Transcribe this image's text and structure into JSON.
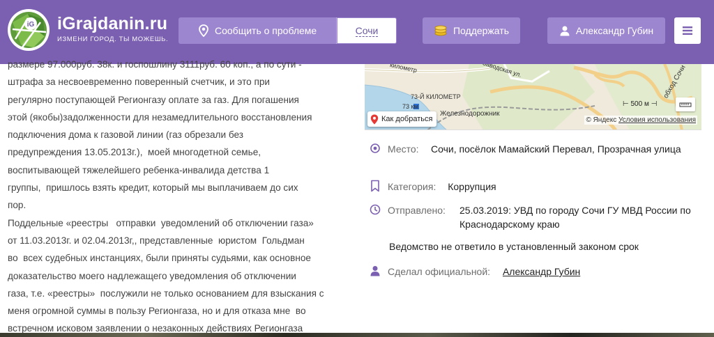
{
  "header": {
    "logo_title": "iGrajdanin.ru",
    "logo_subtitle": "ИЗМЕНИ ГОРОД. ТЫ МОЖЕШЬ.",
    "report_label": "Сообщить о проблеме",
    "city_label": "Сочи",
    "support_label": "Поддержать",
    "user_label": "Александр Губин",
    "menu_icon": "hamburger-icon",
    "accent_color": "#7b5fb0"
  },
  "article": {
    "text": "размере 97.000руб. 38к. и госпошлину 3111руб. 60 коп., а по сути -\nштрафа за несвоевременно поверенный счетчик, и это при\nрегулярно поступающей Регионгазу оплате за газ. Для погашения\nэтой (якобы)задолженности для незамедлительного восстановления\nподключения дома к газовой линии (газ обрезали без\nпредупреждения 13.05.2013г.),  моей многодетной семье,\nвоспитывающей тяжелейшего ребенка-инвалида детства 1\nгруппы,  пришлось взять кредит, который мы выплачиваем до сих\nпор.\nПоддельные «реестры   отправки  уведомлений об отключении газа»\nот 11.03.2013г. и 02.04.2013г,, представленные  юристом  Гольдман\nво  всех судебных инстанциях, были приняты судьями, как основное\nдоказательство моего надлежащего уведомления об отключении\nгаза, т.е. «реестры»  послужили не только основанием для взыскания с\nменя огромной суммы в пользу Регионгаза, но и для отказа мне  во\nвстречном исковом заявлении о незаконных действиях Регионгаза"
  },
  "map": {
    "route_label": "Как добраться",
    "label_km": "73-Й КИЛОМЕТР",
    "label_73km": "73 км",
    "label_rail": "Железнодорожник",
    "label_kilometer": "километр",
    "label_street": "Заводская ул.",
    "label_sochi": "обход Сочи",
    "scale_label": "500 м",
    "copyright_prefix": "© Яндекс",
    "copyright_link": "Условия использования"
  },
  "details": {
    "place_label": "Место:",
    "place_value": "Сочи, посёлок Мамайский Перевал, Прозрачная улица",
    "category_label": "Категория:",
    "category_value": "Коррупция",
    "sent_label": "Отправлено:",
    "sent_value": "25.03.2019: УВД по городу Сочи ГУ МВД России по Краснодарскому краю",
    "note": "Ведомство не ответило в установленный законом срок",
    "official_label": "Сделал официальной:",
    "official_value": "Александр Губин"
  }
}
